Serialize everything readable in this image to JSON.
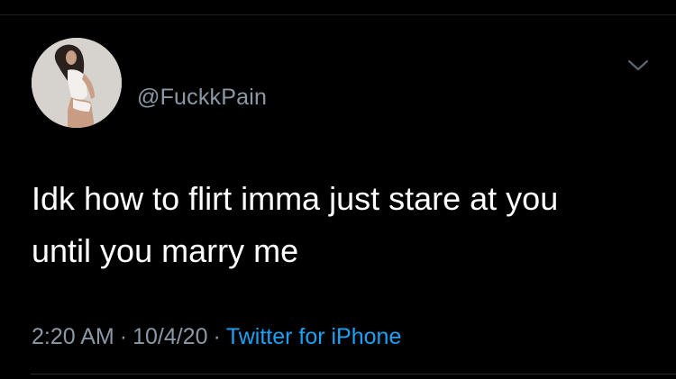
{
  "tweet": {
    "username": "@FuckkPain",
    "text": "Idk how to flirt imma just stare at you\nuntil you marry me",
    "time": "2:20 AM",
    "date": "10/4/20",
    "source": "Twitter for iPhone",
    "separator": "·"
  },
  "icons": {
    "menu": "chevron-down-icon",
    "avatar": "profile-avatar"
  },
  "colors": {
    "background": "#000000",
    "text": "#ffffff",
    "secondary_text": "#8b98a5",
    "link": "#1da1f2"
  }
}
